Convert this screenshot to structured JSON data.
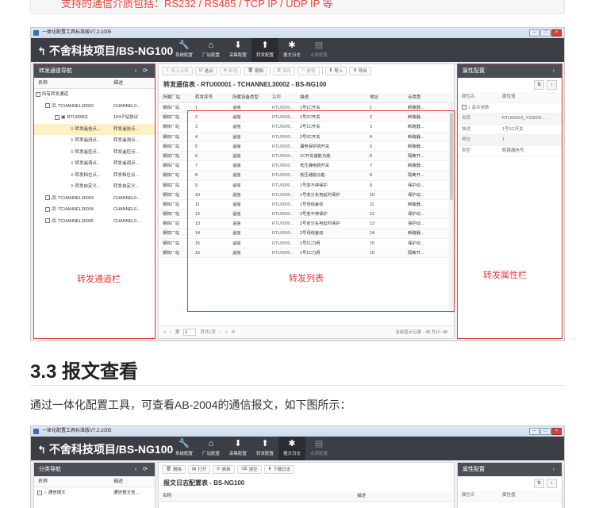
{
  "doc_top_text": "支持的通信介质包括：RS232 / RS485 / TCP IP / UDP IP 等",
  "window": {
    "title": "一体化配置工具标准版V7.2.1005",
    "project": "不舍科技项目/BS-NG100",
    "nav_tabs": [
      {
        "icon": "wrench-icon",
        "glyph": "🔧",
        "label": "系统配置"
      },
      {
        "icon": "home-icon",
        "glyph": "⌂",
        "label": "厂站配置"
      },
      {
        "icon": "download-icon",
        "glyph": "⬇",
        "label": "采集配置"
      },
      {
        "icon": "upload-icon",
        "glyph": "⬆",
        "label": "转发配置"
      },
      {
        "icon": "bug-icon",
        "glyph": "✱",
        "label": "报文日志"
      },
      {
        "icon": "document-icon",
        "glyph": "▤",
        "label": "点表配置"
      }
    ],
    "window_buttons": [
      "–",
      "□",
      "×"
    ]
  },
  "left_panel": {
    "title": "转发通道导航",
    "buttons": "‹ ⟳",
    "columns": [
      "名称",
      "描述"
    ],
    "rows": [
      {
        "indent": 2,
        "toggle": "⊟",
        "icon": "",
        "name": "所有转发通道",
        "desc": ""
      },
      {
        "indent": 14,
        "toggle": "⊟",
        "icon": "network-icon",
        "name": "TCHANNEL30002",
        "desc": "CHANNEL0..."
      },
      {
        "indent": 26,
        "toggle": "⊟",
        "icon": "rtu-icon",
        "name": "RTU00001",
        "desc": "104子站协议"
      },
      {
        "indent": 46,
        "toggle": "",
        "icon": "list-icon",
        "name": "转发遥信点...",
        "desc": "转发遥信点..."
      },
      {
        "indent": 46,
        "toggle": "",
        "icon": "list-icon",
        "name": "转发遥测点...",
        "desc": "转发遥测点..."
      },
      {
        "indent": 46,
        "toggle": "",
        "icon": "list-icon",
        "name": "转发遥控点...",
        "desc": "转发遥控点..."
      },
      {
        "indent": 46,
        "toggle": "",
        "icon": "list-icon",
        "name": "转发遥调点...",
        "desc": "转发遥调点..."
      },
      {
        "indent": 46,
        "toggle": "",
        "icon": "list-icon",
        "name": "转发档位点...",
        "desc": "转发档位点..."
      },
      {
        "indent": 46,
        "toggle": "",
        "icon": "list-icon",
        "name": "转发自定义...",
        "desc": "转发自定义..."
      },
      {
        "indent": 14,
        "toggle": "⊟",
        "icon": "network-icon",
        "name": "TCHANNEL30003",
        "desc": "CHANNEL0..."
      },
      {
        "indent": 14,
        "toggle": "⊟",
        "icon": "network-icon",
        "name": "TCHANNEL30004",
        "desc": "CHANNEL0..."
      },
      {
        "indent": 14,
        "toggle": "⊟",
        "icon": "network-icon",
        "name": "TCHANNEL30005",
        "desc": "CHANNEL0..."
      }
    ],
    "annotation": "转发通道栏"
  },
  "center_panel": {
    "toolbar": [
      {
        "label": "导入点表",
        "icon": "⇩",
        "disabled": true
      },
      {
        "label": "选点",
        "icon": "☑",
        "disabled": false
      },
      {
        "label": "新增",
        "icon": "✚",
        "disabled": true
      },
      {
        "label": "删除",
        "icon": "🗑",
        "disabled": false
      },
      {
        "label": "保存",
        "icon": "🖫",
        "disabled": true
      },
      {
        "label": "撤销",
        "icon": "↶",
        "disabled": true
      },
      {
        "label": "导入",
        "icon": "⬆",
        "disabled": false
      },
      {
        "label": "导出",
        "icon": "⬇",
        "disabled": false
      }
    ],
    "table_title": "转发遥信表 - RTU00001 - TCHANNEL30002 - BS-NG100",
    "columns": [
      "所属厂站",
      "转发序号",
      "所属设备类型",
      "名称",
      "描述",
      "地址",
      "点类型"
    ],
    "rows": [
      [
        "钢铁厂站",
        "1",
        "遥信",
        "RTU0000...",
        "1号1C开关",
        "1",
        "断路器..."
      ],
      [
        "钢铁厂站",
        "2",
        "遥信",
        "RTU0000...",
        "1号2C开关",
        "2",
        "断路器..."
      ],
      [
        "钢铁厂站",
        "3",
        "遥信",
        "RTU0000...",
        "2号1C开关",
        "3",
        "断路器..."
      ],
      [
        "钢铁厂站",
        "4",
        "遥信",
        "RTU0000...",
        "2号2C开关",
        "4",
        "断路器..."
      ],
      [
        "钢铁厂站",
        "5",
        "遥信",
        "RTU0000...",
        "漏电保护跳开关",
        "5",
        "断路器..."
      ],
      [
        "钢铁厂站",
        "6",
        "遥信",
        "RTU0000...",
        "1C开关储能功能",
        "6",
        "隔离开..."
      ],
      [
        "钢铁厂站",
        "7",
        "遥信",
        "RTU0000...",
        "低压漏电跳开关",
        "7",
        "断路器..."
      ],
      [
        "钢铁厂站",
        "8",
        "遥信",
        "RTU0000...",
        "低压储能功能",
        "8",
        "隔离开..."
      ],
      [
        "钢铁厂站",
        "9",
        "遥信",
        "RTU0000...",
        "1号变不停保护",
        "9",
        "保护动..."
      ],
      [
        "钢铁厂站",
        "10",
        "遥信",
        "RTU0000...",
        "1号变分失电延时保护",
        "10",
        "保护动..."
      ],
      [
        "钢铁厂站",
        "11",
        "遥信",
        "RTU0000...",
        "1号母线差动",
        "11",
        "断路器..."
      ],
      [
        "钢铁厂站",
        "12",
        "遥信",
        "RTU0000...",
        "2号变不停保护",
        "12",
        "保护动..."
      ],
      [
        "钢铁厂站",
        "13",
        "遥信",
        "RTU0000...",
        "2号变分失电延时保护",
        "13",
        "保护动..."
      ],
      [
        "钢铁厂站",
        "14",
        "遥信",
        "RTU0000...",
        "2号母线差动",
        "14",
        "断路器..."
      ],
      [
        "钢铁厂站",
        "15",
        "遥信",
        "RTU0000...",
        "1号1C刀闸",
        "15",
        "保护动..."
      ],
      [
        "钢铁厂站",
        "16",
        "遥信",
        "RTU0000...",
        "1号1C刀闸",
        "16",
        "隔离开..."
      ]
    ],
    "pager": {
      "first": "«",
      "prev": "‹",
      "page_label": "第",
      "page_value": "1",
      "page_total": "页共1页",
      "next": "›",
      "last": "»",
      "refresh": "⟳",
      "status": "当前显示记录 - 48 共计: 48"
    },
    "annotation": "转发列表"
  },
  "right_panel": {
    "title": "属性配置",
    "arrow": "›",
    "tool_icons": [
      "⇅",
      "↕"
    ],
    "columns": [
      "属性名",
      "属性值"
    ],
    "group": "1 基本参数",
    "props": [
      {
        "k": "名称",
        "v": "RTU00001_YX0000..."
      },
      {
        "k": "描述",
        "v": "1号1C开关"
      },
      {
        "k": "地址",
        "v": "1"
      },
      {
        "k": "类型",
        "v": "断路器信号"
      }
    ],
    "annotation": "转发属性栏"
  },
  "section_title": "3.3 报文查看",
  "section_desc": "通过一体化配置工具，可查看AB-2004的通信报文，如下图所示：",
  "window2": {
    "title": "一体化配置工具标准版V7.2.1005",
    "project": "不舍科技项目/BS-NG100",
    "left_title": "分类导航",
    "left_buttons": "‹ ⟳",
    "left_columns": [
      "名称",
      "描述"
    ],
    "left_row": {
      "name": "通信报文",
      "desc": "通信报文信..."
    },
    "toolbar": [
      {
        "label": "删除",
        "icon": "🗑"
      },
      {
        "label": "打开",
        "icon": "▤"
      },
      {
        "label": "刷新",
        "icon": "⟳"
      },
      {
        "label": "清空",
        "icon": "⌫"
      },
      {
        "label": "下载日志",
        "icon": "⬇"
      }
    ],
    "table_title": "报文日志配置表 - BS-NG100",
    "columns": [
      "名称",
      "描述"
    ],
    "right_title": "属性配置",
    "right_columns": [
      "属性名",
      "属性值"
    ]
  }
}
